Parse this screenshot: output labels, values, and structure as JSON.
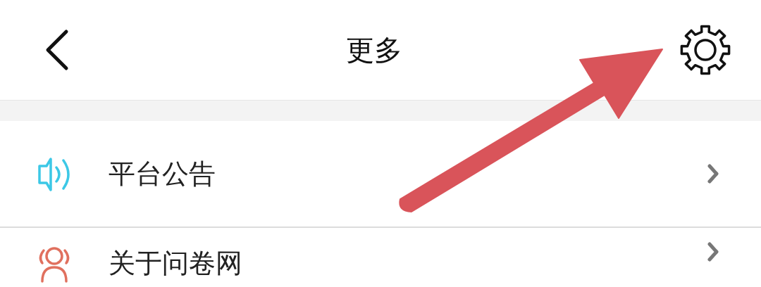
{
  "header": {
    "title": "更多"
  },
  "menu": [
    {
      "label": "平台公告",
      "kind": "announcement"
    },
    {
      "label": "关于问卷网",
      "kind": "about"
    }
  ]
}
